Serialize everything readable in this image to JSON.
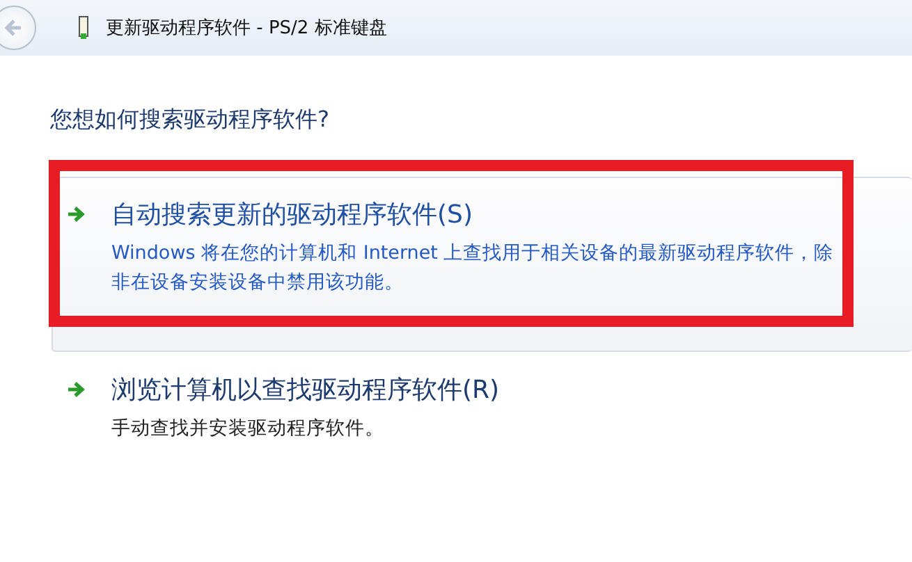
{
  "window": {
    "title": "更新驱动程序软件 - PS/2 标准键盘"
  },
  "question": "您想如何搜索驱动程序软件?",
  "options": [
    {
      "title": "自动搜索更新的驱动程序软件(S)",
      "description": "Windows 将在您的计算机和 Internet 上查找用于相关设备的最新驱动程序软件，除非在设备安装设备中禁用该功能。",
      "hovered": true,
      "marked": true
    },
    {
      "title": "浏览计算机以查找驱动程序软件(R)",
      "description": "手动查找并安装驱动程序软件。",
      "hovered": false,
      "marked": false
    }
  ]
}
